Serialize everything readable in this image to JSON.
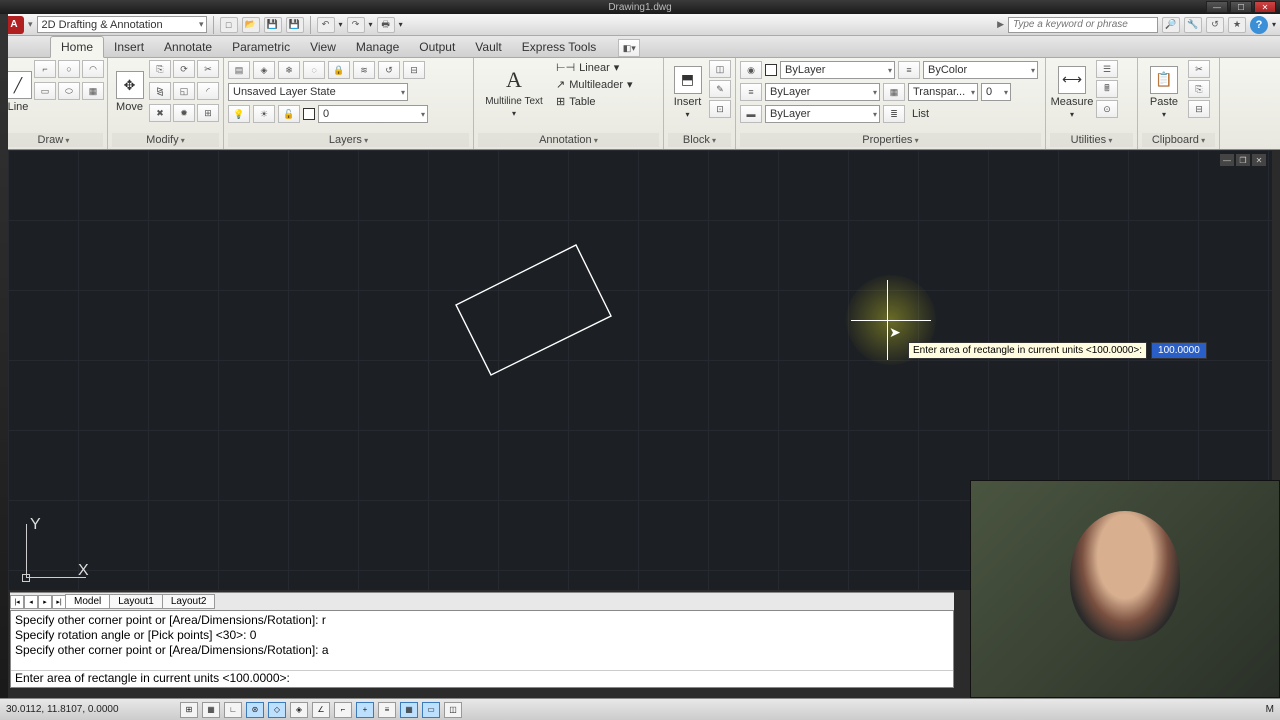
{
  "app": {
    "title": "Drawing1.dwg",
    "workspace": "2D Drafting & Annotation",
    "search_placeholder": "Type a keyword or phrase"
  },
  "tabs": {
    "items": [
      "Home",
      "Insert",
      "Annotate",
      "Parametric",
      "View",
      "Manage",
      "Output",
      "Vault",
      "Express Tools"
    ],
    "active": "Home"
  },
  "ribbon": {
    "draw": {
      "title": "Draw",
      "line": "Line"
    },
    "modify": {
      "title": "Modify",
      "move": "Move"
    },
    "layers": {
      "title": "Layers",
      "state": "Unsaved Layer State",
      "current": "0"
    },
    "annotation": {
      "title": "Annotation",
      "mtext": "Multiline Text",
      "linear": "Linear",
      "mleader": "Multileader",
      "table": "Table"
    },
    "block": {
      "title": "Block",
      "insert": "Insert"
    },
    "properties": {
      "title": "Properties",
      "layer_color": "ByLayer",
      "plot_style": "ByColor",
      "linetype": "ByLayer",
      "lineweight": "ByLayer",
      "transparency_label": "Transpar...",
      "transparency_value": "0",
      "list": "List"
    },
    "utilities": {
      "title": "Utilities",
      "measure": "Measure"
    },
    "clipboard": {
      "title": "Clipboard",
      "paste": "Paste"
    }
  },
  "canvas": {
    "ucs_y": "Y",
    "ucs_x": "X",
    "dyn_prompt": "Enter area of rectangle in current units <100.0000>:",
    "dyn_value": "100.0000"
  },
  "layout_tabs": {
    "items": [
      "Model",
      "Layout1",
      "Layout2"
    ],
    "active": "Model"
  },
  "cmd": {
    "lines": [
      "Specify other corner point or [Area/Dimensions/Rotation]: r",
      "Specify rotation angle or [Pick points] <30>: 0",
      "Specify other corner point or [Area/Dimensions/Rotation]: a",
      "Enter area of rectangle in current units <100.0000>:"
    ]
  },
  "status": {
    "coords": "30.0112, 11.8107, 0.0000",
    "mode_hint": "M"
  }
}
